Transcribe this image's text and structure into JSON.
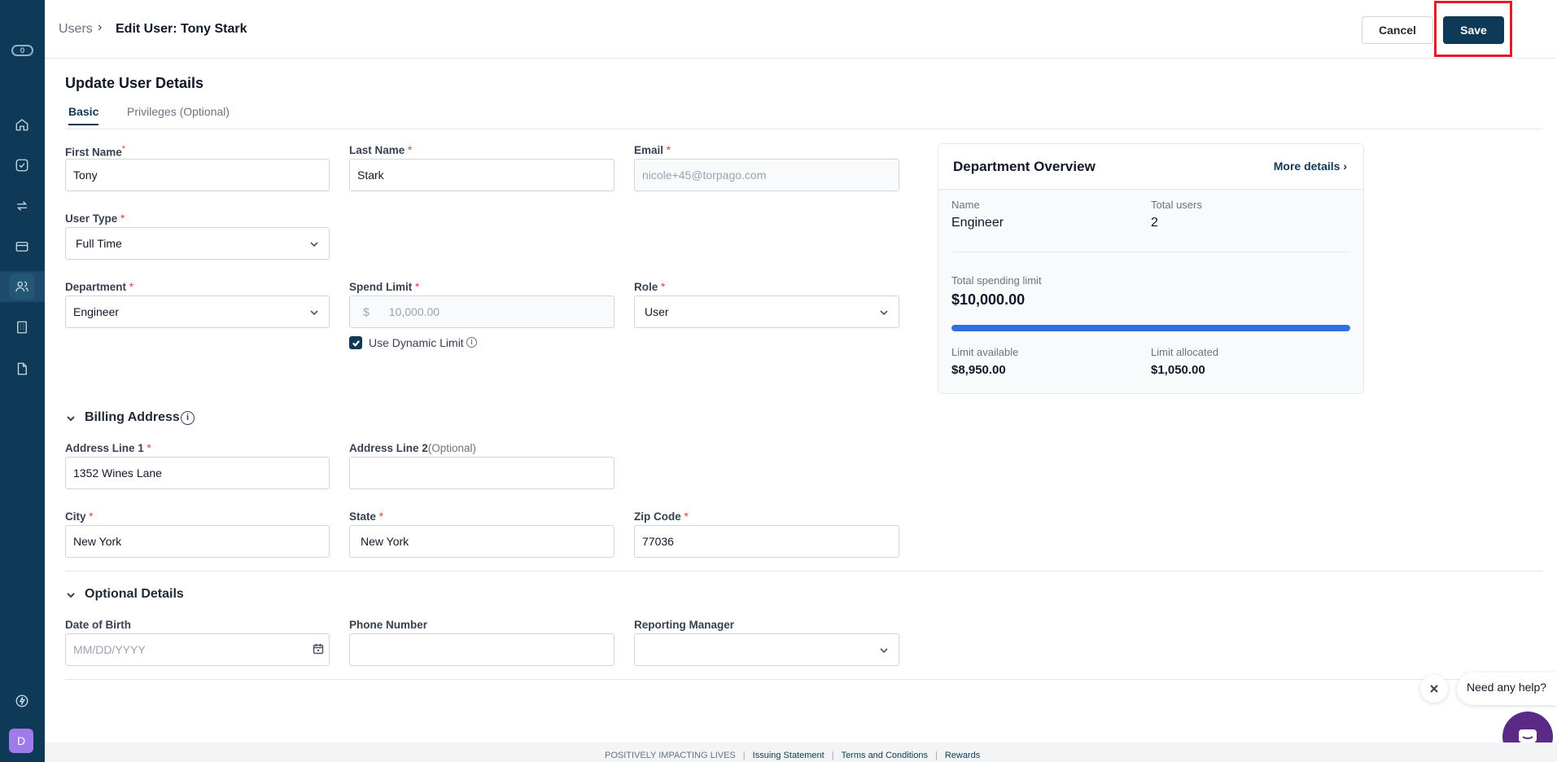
{
  "breadcrumb": {
    "root": "Users",
    "separator": "›",
    "current": "Edit User: Tony Stark"
  },
  "actions": {
    "cancel": "Cancel",
    "save": "Save"
  },
  "sidebar": {
    "logo_text": "0",
    "items": [
      {
        "icon": "home-icon"
      },
      {
        "icon": "check-circle-icon"
      },
      {
        "icon": "transfer-icon"
      },
      {
        "icon": "card-icon"
      },
      {
        "icon": "users-icon"
      },
      {
        "icon": "building-icon"
      },
      {
        "icon": "document-icon"
      },
      {
        "icon": "lightning-icon"
      }
    ],
    "active_item": "users-icon",
    "avatar": "D"
  },
  "form": {
    "title": "Update User Details",
    "tabs": [
      "Basic",
      "Privileges (Optional)"
    ],
    "first_name": {
      "label": "First Name",
      "value": "Tony"
    },
    "last_name": {
      "label": "Last Name",
      "value": "Stark"
    },
    "email": {
      "label": "Email",
      "value": "nicole+45@torpago.com"
    },
    "user_type": {
      "label": "User Type",
      "value": "Full Time"
    },
    "department": {
      "label": "Department",
      "value": "Engineer"
    },
    "spend_limit": {
      "label": "Spend Limit",
      "currency": "$",
      "value": "10,000.00"
    },
    "dynamic_limit": {
      "label": "Use Dynamic Limit",
      "checked": true
    },
    "role": {
      "label": "Role",
      "value": "User"
    },
    "required_marker": "*"
  },
  "billing": {
    "title": "Billing Address",
    "info_glyph": "i",
    "address1": {
      "label": "Address Line 1",
      "value": "1352 Wines Lane"
    },
    "address2": {
      "label": "Address Line 2",
      "optional": "(Optional)",
      "value": ""
    },
    "city": {
      "label": "City",
      "value": "New York"
    },
    "state": {
      "label": "State",
      "value": "New York"
    },
    "zip": {
      "label": "Zip Code",
      "value": "77036"
    }
  },
  "optional": {
    "title": "Optional Details",
    "dob": {
      "label": "Date of Birth",
      "placeholder": "MM/DD/YYYY"
    },
    "phone": {
      "label": "Phone Number",
      "value": ""
    },
    "manager": {
      "label": "Reporting Manager",
      "value": ""
    }
  },
  "department_overview": {
    "title": "Department Overview",
    "more": "More details ›",
    "name_label": "Name",
    "name_value": "Engineer",
    "users_label": "Total users",
    "users_value": "2",
    "total_label": "Total spending limit",
    "total_value": "$10,000.00",
    "usage_fraction": 1.0,
    "available_label": "Limit available",
    "available_value": "$8,950.00",
    "allocated_label": "Limit allocated",
    "allocated_value": "$1,050.00"
  },
  "help": {
    "text": "Need any help?"
  },
  "footer": {
    "tagline": "POSITIVELY IMPACTING LIVES",
    "links": [
      "Issuing Statement",
      "Terms and Conditions",
      "Rewards"
    ],
    "separator": "|"
  },
  "colors": {
    "brand": "#0f3a57",
    "accent_bar": "#2f6fe0",
    "required": "#e53e3e",
    "highlight": "#e11d2a",
    "chat": "#5b2a86"
  }
}
